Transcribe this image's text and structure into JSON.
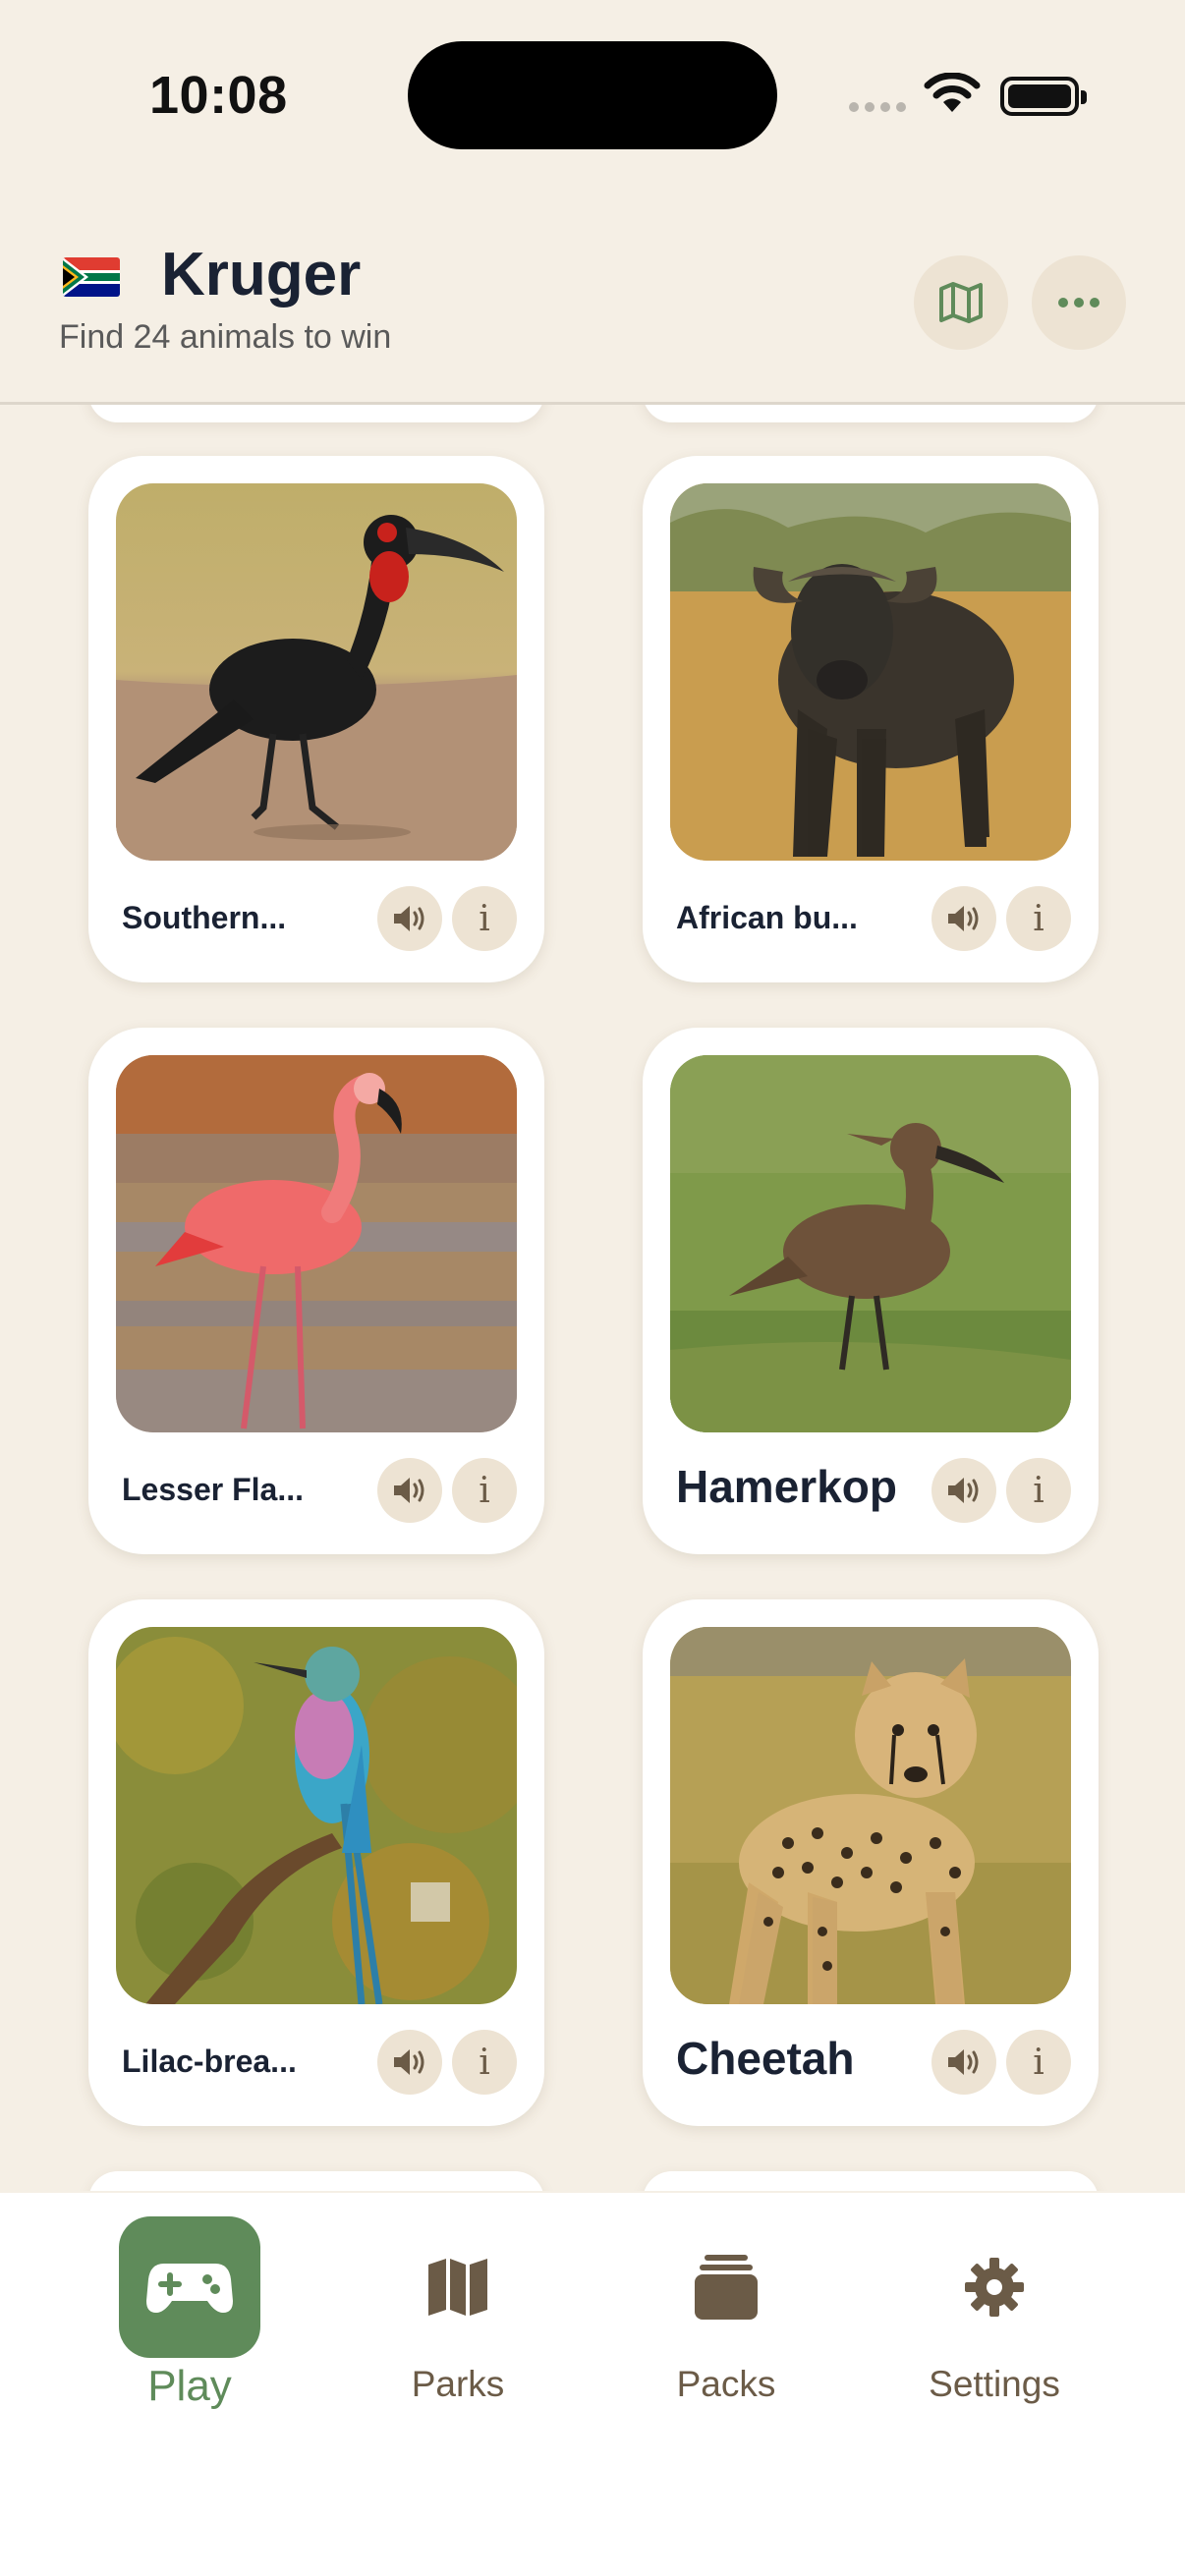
{
  "status_bar": {
    "time": "10:08"
  },
  "header": {
    "title": "Kruger",
    "subtitle": "Find 24 animals to win",
    "flag": "south-africa-flag",
    "map_button_icon": "map-icon",
    "more_button_icon": "more-icon"
  },
  "cards": [
    {
      "name": "Southern...",
      "photo": "southern-ground-hornbill"
    },
    {
      "name": "African bu...",
      "photo": "african-buffalo"
    },
    {
      "name": "Lesser Fla...",
      "photo": "lesser-flamingo"
    },
    {
      "name": "Hamerkop",
      "photo": "hamerkop"
    },
    {
      "name": "Lilac-brea...",
      "photo": "lilac-breasted-roller"
    },
    {
      "name": "Cheetah",
      "photo": "cheetah"
    }
  ],
  "card_actions": {
    "sound_icon": "speaker-icon",
    "info_label": "i"
  },
  "tabs": [
    {
      "label": "Play",
      "icon": "gamepad-icon",
      "active": true
    },
    {
      "label": "Parks",
      "icon": "map-icon",
      "active": false
    },
    {
      "label": "Packs",
      "icon": "stack-icon",
      "active": false
    },
    {
      "label": "Settings",
      "icon": "gear-icon",
      "active": false
    }
  ],
  "colors": {
    "accent": "#5f8b5a",
    "background": "#f5efe5",
    "chip": "#ede3d3",
    "muted": "#6b5b47"
  }
}
